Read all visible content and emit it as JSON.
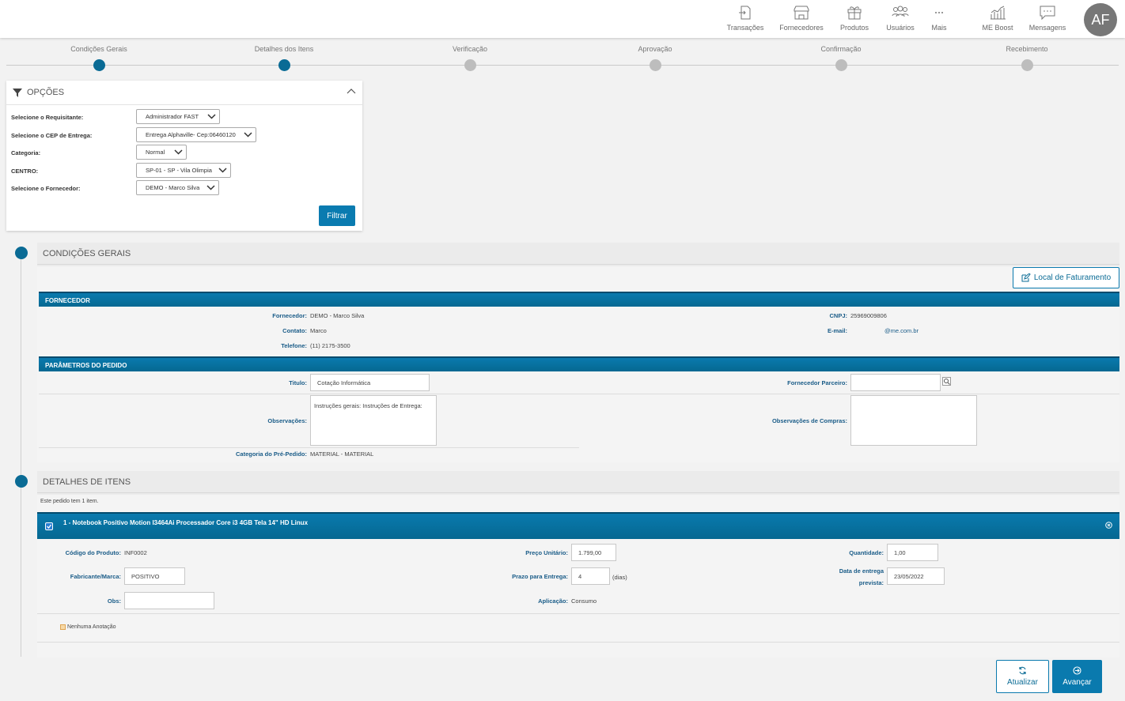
{
  "nav": {
    "items": [
      {
        "label": "Transações",
        "icon": "transactions-icon"
      },
      {
        "label": "Fornecedores",
        "icon": "store-icon"
      },
      {
        "label": "Produtos",
        "icon": "box-icon"
      },
      {
        "label": "Usuários",
        "icon": "users-icon"
      },
      {
        "label": "Mais",
        "icon": "more-icon"
      },
      {
        "label": "ME Boost",
        "icon": "chart-icon"
      },
      {
        "label": "Mensagens",
        "icon": "message-icon"
      }
    ],
    "avatar": "AF"
  },
  "stepper": [
    {
      "label": "Condições Gerais",
      "done": true
    },
    {
      "label": "Detalhes dos Itens",
      "done": true
    },
    {
      "label": "Verificação",
      "done": false
    },
    {
      "label": "Aprovação",
      "done": false
    },
    {
      "label": "Confirmação",
      "done": false
    },
    {
      "label": "Recebimento",
      "done": false
    }
  ],
  "options": {
    "title": "OPÇÕES",
    "rows": [
      {
        "label": "Selecione o Requisitante:",
        "value": "Administrador FAST"
      },
      {
        "label": "Selecione o CEP de Entrega:",
        "value": "Entrega Alphaville- Cep:06460120"
      },
      {
        "label": "Categoria:",
        "value": "Normal"
      },
      {
        "label": "CENTRO:",
        "value": "SP-01 - SP - Vila Olimpia"
      },
      {
        "label": "Selecione o Fornecedor:",
        "value": "DEMO - Marco Silva"
      }
    ],
    "filter_button": "Filtrar"
  },
  "condicoes": {
    "title": "CONDIÇÕES GERAIS",
    "local_button": "Local de Faturamento",
    "fornecedor_header": "FORNECEDOR",
    "fornecedor_label": "Fornecedor:",
    "fornecedor_value": "DEMO - Marco Silva",
    "contato_label": "Contato:",
    "contato_value": "Marco",
    "telefone_label": "Telefone:",
    "telefone_value": "(11) 2175-3500",
    "cnpj_label": "CNPJ:",
    "cnpj_value": "25969009806",
    "email_label": "E-mail:",
    "email_value": "@me.com.br",
    "params_header": "PARÂMETROS DO PEDIDO",
    "titulo_label": "Titulo:",
    "titulo_value": "Cotação Informática",
    "parceiro_label": "Fornecedor Parceiro:",
    "parceiro_value": "",
    "obs_label": "Observações:",
    "obs_value": "Instruções gerais:    Instruções de Entrega:",
    "obs_compras_label": "Observações de Compras:",
    "obs_compras_value": "",
    "categoria_label": "Categoria do Pré-Pedido:",
    "categoria_value": "MATERIAL - MATERIAL"
  },
  "detalhes": {
    "title": "DETALHES DE ITENS",
    "count_text": "Este pedido tem 1 item.",
    "item_title": "1 - Notebook Positivo Motion I3464Ai Processador Core i3 4GB Tela 14\" HD Linux",
    "codigo_label": "Código do Produto:",
    "codigo_value": "INF0002",
    "preco_label": "Preço Unitário:",
    "preco_value": "1.799,00",
    "quantidade_label": "Quantidade:",
    "quantidade_value": "1,00",
    "fabricante_label": "Fabricante/Marca:",
    "fabricante_value": "POSITIVO",
    "prazo_label": "Prazo para Entrega:",
    "prazo_value": "4",
    "prazo_unit": "(dias)",
    "data_label_1": "Data de entrega",
    "data_label_2": "prevista:",
    "data_value": "23/05/2022",
    "obs_label": "Obs:",
    "obs_value": "",
    "aplicacao_label": "Aplicação:",
    "aplicacao_value": "Consumo",
    "anotacao": "Nenhuma Anotação"
  },
  "actions": {
    "atualizar": "Atualizar",
    "avancar": "Avançar"
  },
  "colors": {
    "primary": "#0a7aae",
    "dark": "#0a6b95"
  }
}
